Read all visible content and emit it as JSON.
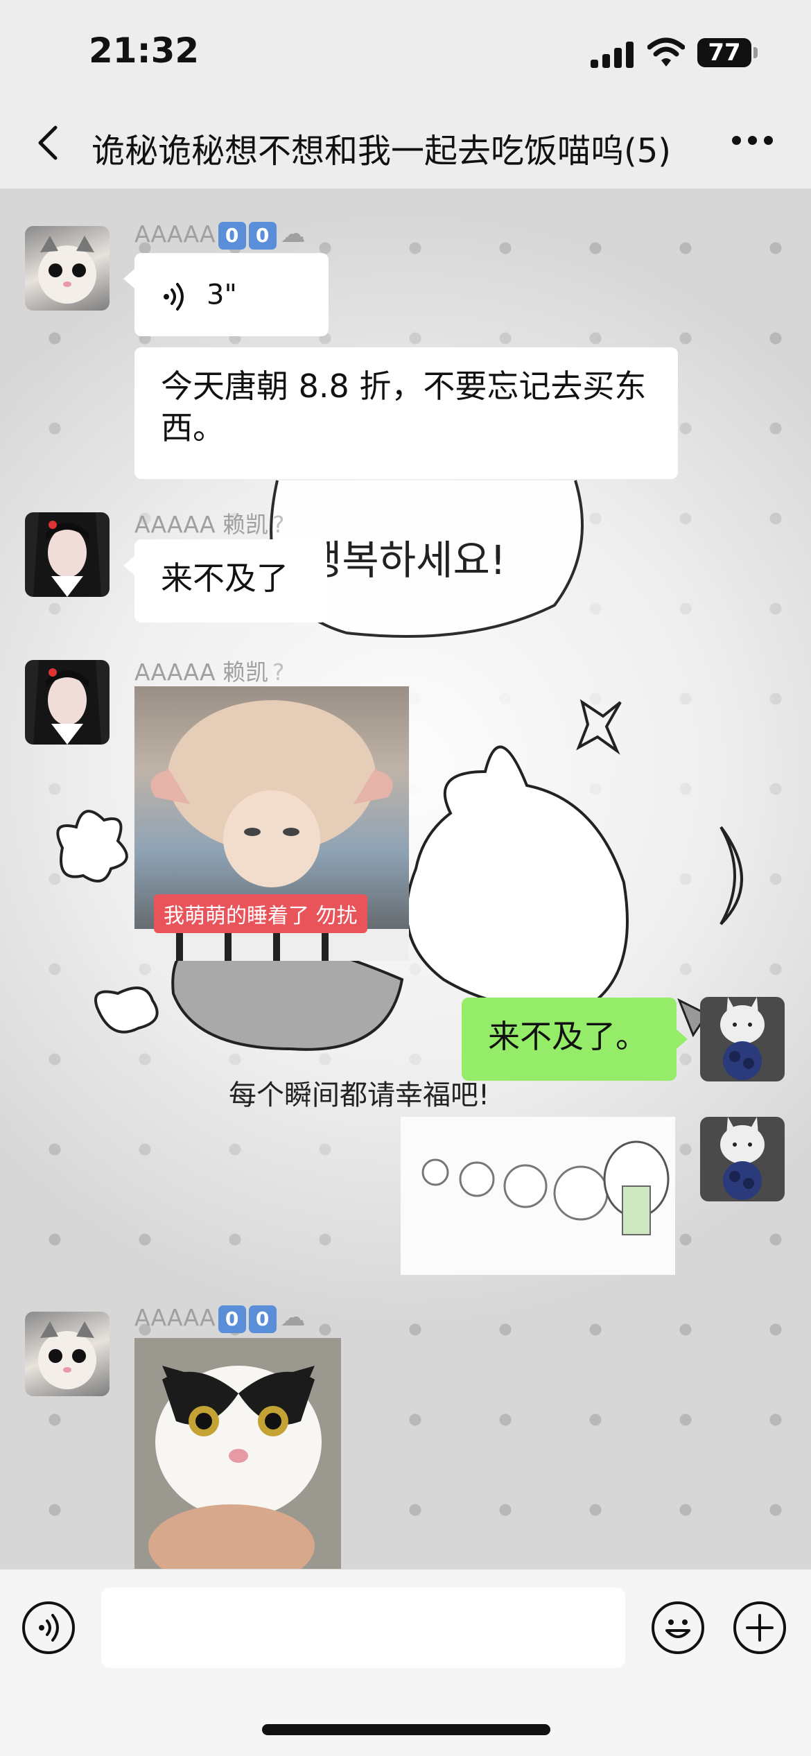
{
  "status_bar": {
    "time": "21:32",
    "battery": "77"
  },
  "header": {
    "title": "诡秘诡秘想不想和我一起去吃饭喵呜",
    "member_count": "(5)"
  },
  "messages": {
    "m1": {
      "sender": "AAAAA",
      "badges": [
        "0",
        "0"
      ],
      "voice_duration": "3\"",
      "text": "今天唐朝 8.8 折，不要忘记去买东西。"
    },
    "m2": {
      "sender": "AAAAA 赖凯",
      "text": "来不及了"
    },
    "m3": {
      "sender": "AAAAA 赖凯",
      "image_caption": "我萌萌的睡着了 勿扰"
    },
    "m4": {
      "text": "来不及了。"
    },
    "m6": {
      "sender": "AAAAA",
      "badges": [
        "0",
        "0"
      ]
    }
  },
  "wallpaper": {
    "line1": "행복하세요!",
    "line2": "每个瞬间都请幸福吧!"
  },
  "input_bar": {
    "placeholder": ""
  },
  "colors": {
    "accent_green": "#95ec69",
    "badge_blue": "#5b8ed8"
  }
}
